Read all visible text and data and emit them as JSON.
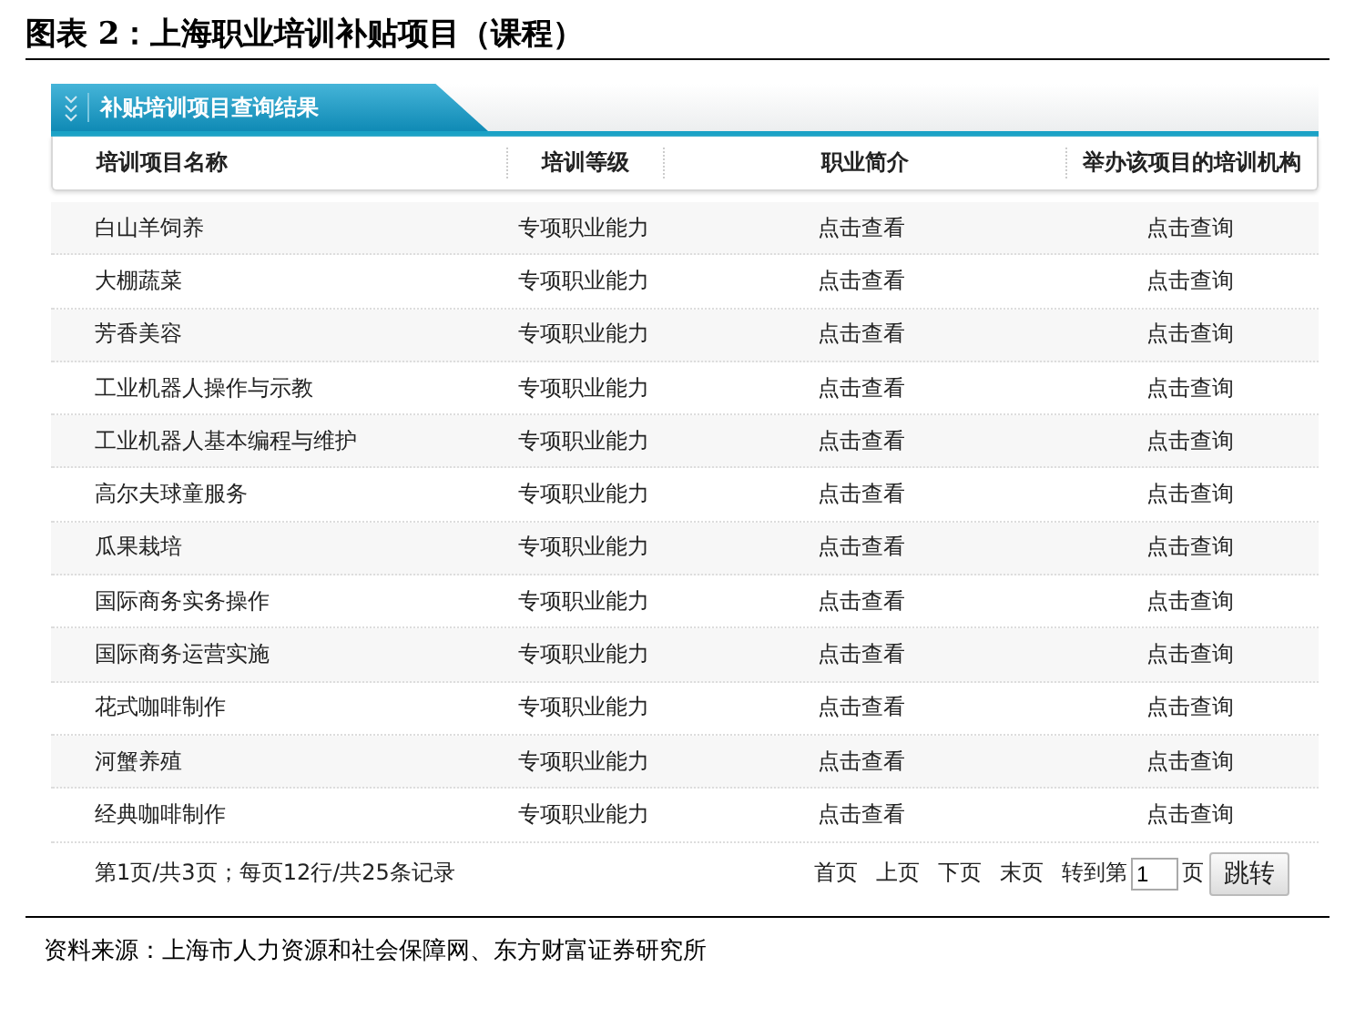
{
  "figure_title": "图表 2：上海职业培训补贴项目（课程）",
  "panel": {
    "tab": "补贴培训项目查询结果"
  },
  "table": {
    "columns": [
      "培训项目名称",
      "培训等级",
      "职业简介",
      "举办该项目的培训机构"
    ],
    "rows": [
      [
        "白山羊饲养",
        "专项职业能力",
        "点击查看",
        "点击查询"
      ],
      [
        "大棚蔬菜",
        "专项职业能力",
        "点击查看",
        "点击查询"
      ],
      [
        "芳香美容",
        "专项职业能力",
        "点击查看",
        "点击查询"
      ],
      [
        "工业机器人操作与示教",
        "专项职业能力",
        "点击查看",
        "点击查询"
      ],
      [
        "工业机器人基本编程与维护",
        "专项职业能力",
        "点击查看",
        "点击查询"
      ],
      [
        "高尔夫球童服务",
        "专项职业能力",
        "点击查看",
        "点击查询"
      ],
      [
        "瓜果栽培",
        "专项职业能力",
        "点击查看",
        "点击查询"
      ],
      [
        "国际商务实务操作",
        "专项职业能力",
        "点击查看",
        "点击查询"
      ],
      [
        "国际商务运营实施",
        "专项职业能力",
        "点击查看",
        "点击查询"
      ],
      [
        "花式咖啡制作",
        "专项职业能力",
        "点击查看",
        "点击查询"
      ],
      [
        "河蟹养殖",
        "专项职业能力",
        "点击查看",
        "点击查询"
      ],
      [
        "经典咖啡制作",
        "专项职业能力",
        "点击查看",
        "点击查询"
      ]
    ]
  },
  "pager": {
    "summary": "第1页/共3页；每页12行/共25条记录",
    "links": [
      "首页",
      "上页",
      "下页",
      "末页"
    ],
    "goto_label": "转到第",
    "page_value": "1",
    "page_suffix": "页",
    "jump_button": "跳转"
  },
  "source": "资料来源：上海市人力资源和社会保障网、东方财富证券研究所"
}
